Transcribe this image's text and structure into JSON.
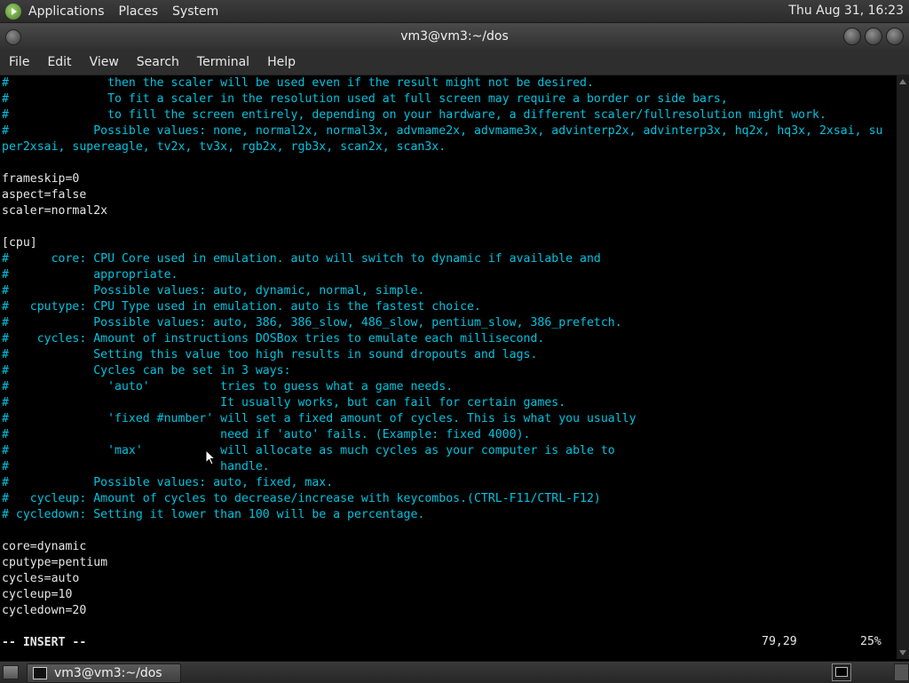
{
  "top_panel": {
    "menus": [
      "Applications",
      "Places",
      "System"
    ],
    "clock": "Thu Aug 31, 16:23"
  },
  "window": {
    "title": "vm3@vm3:~/dos"
  },
  "menubar": [
    "File",
    "Edit",
    "View",
    "Search",
    "Terminal",
    "Help"
  ],
  "terminal": {
    "lines": [
      [
        "#              then the scaler will be used even if the result might not be desired.",
        "c"
      ],
      [
        "#              To fit a scaler in the resolution used at full screen may require a border or side bars,",
        "c"
      ],
      [
        "#              to fill the screen entirely, depending on your hardware, a different scaler/fullresolution might work.",
        "c"
      ],
      [
        "#            Possible values: none, normal2x, normal3x, advmame2x, advmame3x, advinterp2x, advinterp3x, hq2x, hq3x, 2xsai, su",
        "c"
      ],
      [
        "per2xsai, supereagle, tv2x, tv3x, rgb2x, rgb3x, scan2x, scan3x.",
        "c"
      ],
      [
        "",
        "t"
      ],
      [
        "frameskip=0",
        "t"
      ],
      [
        "aspect=false",
        "t"
      ],
      [
        "scaler=normal2x",
        "t"
      ],
      [
        "",
        "t"
      ],
      [
        "[cpu]",
        "t"
      ],
      [
        "#      core: CPU Core used in emulation. auto will switch to dynamic if available and",
        "c"
      ],
      [
        "#            appropriate.",
        "c"
      ],
      [
        "#            Possible values: auto, dynamic, normal, simple.",
        "c"
      ],
      [
        "#   cputype: CPU Type used in emulation. auto is the fastest choice.",
        "c"
      ],
      [
        "#            Possible values: auto, 386, 386_slow, 486_slow, pentium_slow, 386_prefetch.",
        "c"
      ],
      [
        "#    cycles: Amount of instructions DOSBox tries to emulate each millisecond.",
        "c"
      ],
      [
        "#            Setting this value too high results in sound dropouts and lags.",
        "c"
      ],
      [
        "#            Cycles can be set in 3 ways:",
        "c"
      ],
      [
        "#              'auto'          tries to guess what a game needs.",
        "c"
      ],
      [
        "#                              It usually works, but can fail for certain games.",
        "c"
      ],
      [
        "#              'fixed #number' will set a fixed amount of cycles. This is what you usually",
        "c"
      ],
      [
        "#                              need if 'auto' fails. (Example: fixed 4000).",
        "c"
      ],
      [
        "#              'max'           will allocate as much cycles as your computer is able to",
        "c"
      ],
      [
        "#                              handle.",
        "c"
      ],
      [
        "#            Possible values: auto, fixed, max.",
        "c"
      ],
      [
        "#   cycleup: Amount of cycles to decrease/increase with keycombos.(CTRL-F11/CTRL-F12)",
        "c"
      ],
      [
        "# cycledown: Setting it lower than 100 will be a percentage.",
        "c"
      ],
      [
        "",
        "t"
      ],
      [
        "core=dynamic",
        "t"
      ],
      [
        "cputype=pentium",
        "t"
      ],
      [
        "cycles=auto",
        "t"
      ],
      [
        "cycleup=10",
        "t"
      ],
      [
        "cycledown=20",
        "t"
      ],
      [
        "",
        "t"
      ],
      [
        "-- INSERT --",
        "b"
      ]
    ],
    "cursor_position": "79,29",
    "scroll_percent": "25%"
  },
  "taskbar": {
    "task_label": "vm3@vm3:~/dos"
  }
}
